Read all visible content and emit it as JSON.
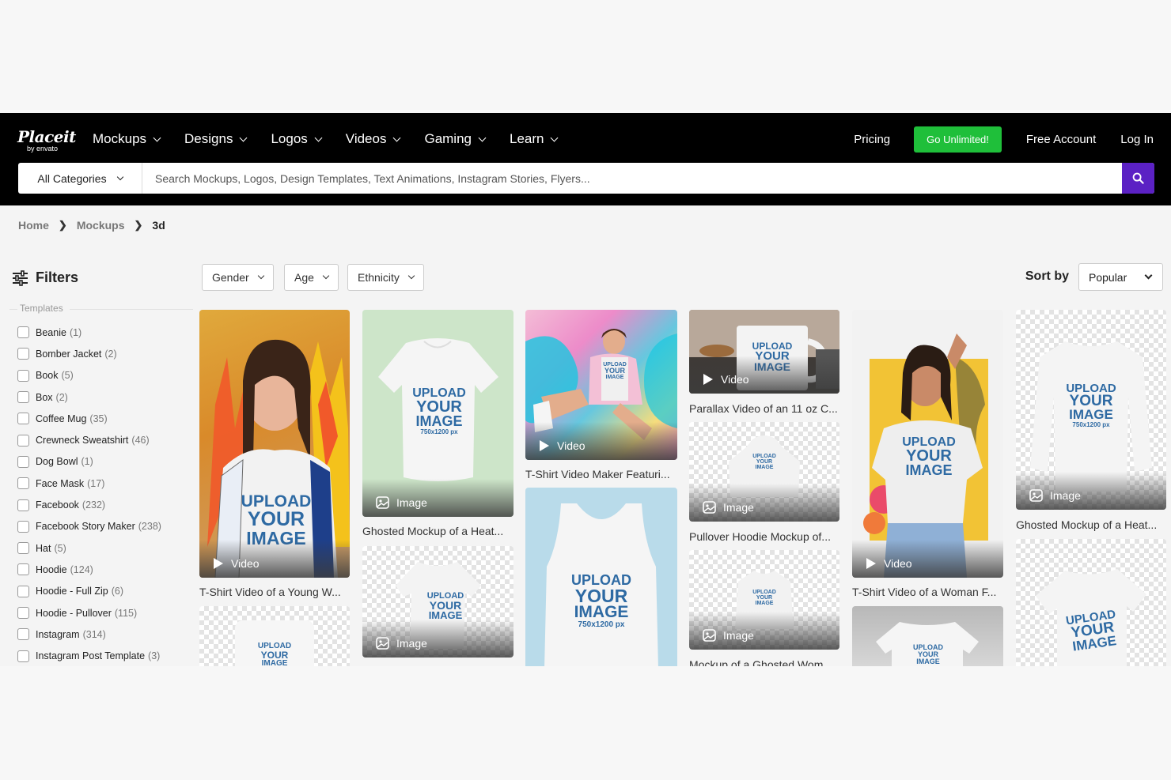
{
  "logo": {
    "main": "Placeit",
    "sub": "by envato"
  },
  "nav": [
    {
      "label": "Mockups"
    },
    {
      "label": "Designs"
    },
    {
      "label": "Logos"
    },
    {
      "label": "Videos"
    },
    {
      "label": "Gaming"
    },
    {
      "label": "Learn"
    }
  ],
  "header": {
    "pricing": "Pricing",
    "go_unlimited": "Go Unlimited!",
    "free_account": "Free Account",
    "login": "Log In"
  },
  "search": {
    "category": "All Categories",
    "placeholder": "Search Mockups, Logos, Design Templates, Text Animations, Instagram Stories, Flyers..."
  },
  "breadcrumb": [
    "Home",
    "Mockups",
    "3d"
  ],
  "filters": {
    "title": "Filters",
    "section": "Templates",
    "items": [
      {
        "label": "Beanie",
        "count": "(1)"
      },
      {
        "label": "Bomber Jacket",
        "count": "(2)"
      },
      {
        "label": "Book",
        "count": "(5)"
      },
      {
        "label": "Box",
        "count": "(2)"
      },
      {
        "label": "Coffee Mug",
        "count": "(35)"
      },
      {
        "label": "Crewneck Sweatshirt",
        "count": "(46)"
      },
      {
        "label": "Dog Bowl",
        "count": "(1)"
      },
      {
        "label": "Face Mask",
        "count": "(17)"
      },
      {
        "label": "Facebook",
        "count": "(232)"
      },
      {
        "label": "Facebook Story Maker",
        "count": "(238)"
      },
      {
        "label": "Hat",
        "count": "(5)"
      },
      {
        "label": "Hoodie",
        "count": "(124)"
      },
      {
        "label": "Hoodie - Full Zip",
        "count": "(6)"
      },
      {
        "label": "Hoodie - Pullover",
        "count": "(115)"
      },
      {
        "label": "Instagram",
        "count": "(314)"
      },
      {
        "label": "Instagram Post Template",
        "count": "(3)"
      }
    ]
  },
  "dropdowns": {
    "gender": "Gender",
    "age": "Age",
    "ethnicity": "Ethnicity"
  },
  "sort": {
    "label": "Sort by",
    "value": "Popular"
  },
  "badges": {
    "video": "Video",
    "image": "Image"
  },
  "upload": {
    "l1": "UPLOAD",
    "l2": "YOUR",
    "l3": "IMAGE",
    "size": "750x1200 px"
  },
  "cards": [
    {
      "caption": "T-Shirt Video of a Young W..."
    },
    {
      "caption": "Ghosted Mockup of a Heat..."
    },
    {
      "caption": "T-Shirt Video Maker Featuri..."
    },
    {
      "caption": "Parallax Video of an 11 oz C..."
    },
    {
      "caption": "Pullover Hoodie Mockup of..."
    },
    {
      "caption": "Mockup of a Ghosted Wom..."
    },
    {
      "caption": "T-Shirt Video of a Woman F..."
    },
    {
      "caption": "Ghosted Mockup of a Heat..."
    }
  ],
  "colors": {
    "topbar": "#000000",
    "go_unlimited": "#1fbf3a",
    "search_button": "#5b21c4"
  }
}
